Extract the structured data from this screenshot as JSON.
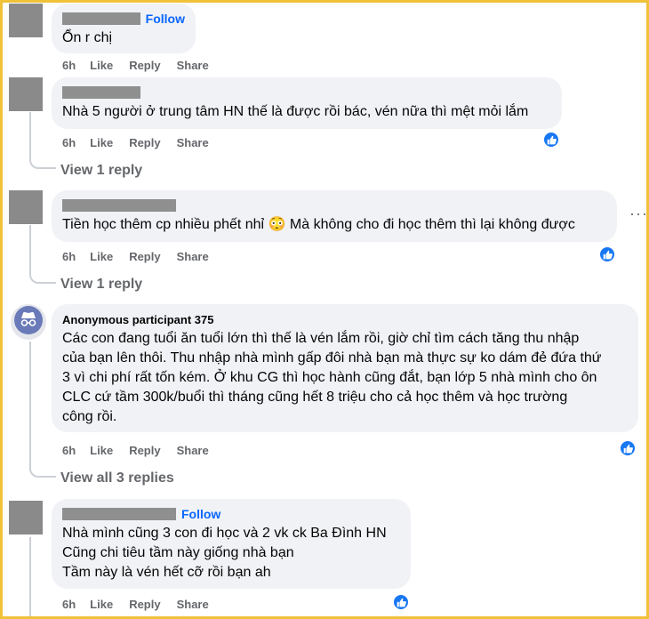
{
  "comments": [
    {
      "follow_label": "Follow",
      "lines": [
        "Ổn r chị"
      ],
      "time": "6h",
      "like": "Like",
      "reply": "Reply",
      "share": "Share"
    },
    {
      "lines": [
        "Nhà 5 người ở trung tâm HN thế là được rồi bác, vén nữa thì mệt mỏi lắm"
      ],
      "time": "6h",
      "like": "Like",
      "reply": "Reply",
      "share": "Share",
      "view_replies": "View 1 reply"
    },
    {
      "lines": [
        "Tiền học thêm cp nhiều phết nhỉ 😳 Mà không cho đi học thêm thì lại không được"
      ],
      "time": "6h",
      "like": "Like",
      "reply": "Reply",
      "share": "Share",
      "view_replies": "View 1 reply"
    },
    {
      "author": "Anonymous participant 375",
      "lines": [
        "Các con đang tuổi ăn tuổi lớn thì thế là vén lắm rồi, giờ chỉ tìm cách tăng thu nhập",
        "của bạn lên thôi. Thu nhập nhà mình gấp đôi nhà bạn mà thực sự ko dám đẻ đứa thứ",
        "3 vì chi phí rất tốn kém. Ở khu CG thì học hành cũng đắt, bạn lớp 5 nhà mình cho ôn",
        "CLC cứ tầm 300k/buổi thì tháng cũng hết 8 triệu cho cả học thêm và học trường",
        "công rồi."
      ],
      "time": "6h",
      "like": "Like",
      "reply": "Reply",
      "share": "Share",
      "view_replies": "View all 3 replies"
    },
    {
      "follow_label": "Follow",
      "lines": [
        "Nhà mình cũng 3 con đi học và 2 vk ck Ba Đình HN",
        "Cũng chi tiêu tầm này giống nhà bạn",
        "Tầm này là vén hết cỡ rồi bạn ah"
      ],
      "time": "6h",
      "like": "Like",
      "reply": "Reply",
      "share": "Share"
    }
  ],
  "colors": {
    "accent": "#0866ff",
    "bubble": "#f0f2f5",
    "muted": "#65676b",
    "frame": "#f0c23a",
    "redaction": "#8f8f8f"
  },
  "icons": [
    "like-reaction-icon",
    "more-options-icon",
    "incognito-icon"
  ]
}
